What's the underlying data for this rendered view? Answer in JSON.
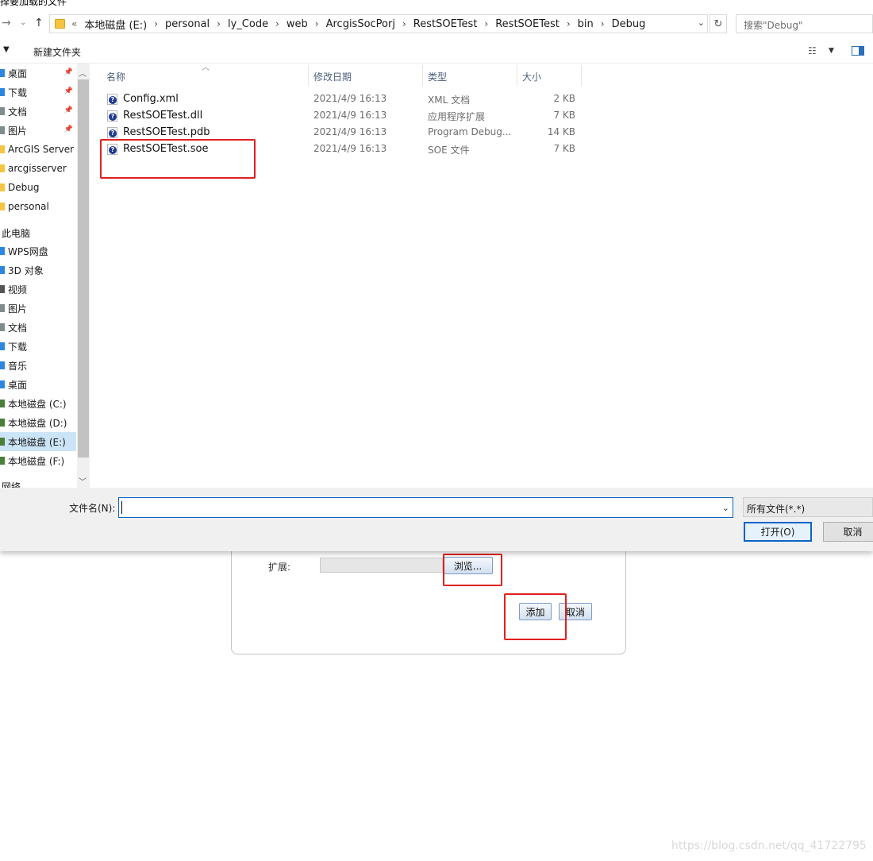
{
  "dialog": {
    "title": "择要加载的文件",
    "breadcrumb": [
      "本地磁盘 (E:)",
      "personal",
      "ly_Code",
      "web",
      "ArcgisSocPorj",
      "RestSOETest",
      "RestSOETest",
      "bin",
      "Debug"
    ],
    "breadcrumb_prefix": "«",
    "search_placeholder": "搜索\"Debug\"",
    "toolbar": {
      "new_folder": "新建文件夹"
    },
    "nav": {
      "quick_access": [
        {
          "label": "桌面",
          "icon": "desktop-icon",
          "color": "#2e86de",
          "pinned": true
        },
        {
          "label": "下载",
          "icon": "download-icon",
          "color": "#2e86de",
          "pinned": true
        },
        {
          "label": "文档",
          "icon": "document-icon",
          "color": "#7f8c8d",
          "pinned": true
        },
        {
          "label": "图片",
          "icon": "picture-icon",
          "color": "#7f8c8d",
          "pinned": true
        },
        {
          "label": "ArcGIS Server",
          "icon": "folder-icon",
          "color": "#f5c441",
          "pinned": false
        },
        {
          "label": "arcgisserver",
          "icon": "folder-icon",
          "color": "#f5c441",
          "pinned": false
        },
        {
          "label": "Debug",
          "icon": "folder-icon",
          "color": "#f5c441",
          "pinned": false
        },
        {
          "label": "personal",
          "icon": "folder-icon",
          "color": "#f5c441",
          "pinned": false
        }
      ],
      "this_pc_label": "此电脑",
      "this_pc": [
        {
          "label": "WPS网盘",
          "icon": "cloud-icon",
          "color": "#2e86de",
          "selected": false
        },
        {
          "label": "3D 对象",
          "icon": "cube-icon",
          "color": "#2e86de",
          "selected": false
        },
        {
          "label": "视频",
          "icon": "video-icon",
          "color": "#555555",
          "selected": false
        },
        {
          "label": "图片",
          "icon": "picture-icon",
          "color": "#7f8c8d",
          "selected": false
        },
        {
          "label": "文档",
          "icon": "document-icon",
          "color": "#7f8c8d",
          "selected": false
        },
        {
          "label": "下载",
          "icon": "download-icon",
          "color": "#2e86de",
          "selected": false
        },
        {
          "label": "音乐",
          "icon": "music-icon",
          "color": "#2e86de",
          "selected": false
        },
        {
          "label": "桌面",
          "icon": "desktop-icon",
          "color": "#2e86de",
          "selected": false
        },
        {
          "label": "本地磁盘 (C:)",
          "icon": "drive-icon",
          "color": "#4a7f3a",
          "selected": false
        },
        {
          "label": "本地磁盘 (D:)",
          "icon": "drive-icon",
          "color": "#4a7f3a",
          "selected": false
        },
        {
          "label": "本地磁盘 (E:)",
          "icon": "drive-icon",
          "color": "#4a7f3a",
          "selected": true
        },
        {
          "label": "本地磁盘 (F:)",
          "icon": "drive-icon",
          "color": "#4a7f3a",
          "selected": false
        }
      ],
      "network_label": "网络"
    },
    "columns": {
      "name": "名称",
      "date": "修改日期",
      "type": "类型",
      "size": "大小"
    },
    "files": [
      {
        "name": "Config.xml",
        "date": "2021/4/9 16:13",
        "type": "XML 文档",
        "size": "2 KB"
      },
      {
        "name": "RestSOETest.dll",
        "date": "2021/4/9 16:13",
        "type": "应用程序扩展",
        "size": "7 KB"
      },
      {
        "name": "RestSOETest.pdb",
        "date": "2021/4/9 16:13",
        "type": "Program Debug...",
        "size": "14 KB"
      },
      {
        "name": "RestSOETest.soe",
        "date": "2021/4/9 16:13",
        "type": "SOE 文件",
        "size": "7 KB"
      }
    ],
    "filename_label": "文件名(N):",
    "filename_value": "",
    "file_type": "所有文件(*.*)",
    "open_button": "打开(O)",
    "cancel_button": "取消"
  },
  "web_form": {
    "extension_label": "扩展:",
    "browse_button": "浏览...",
    "add_button": "添加",
    "cancel_button": "取消"
  },
  "watermark": "https://blog.csdn.net/qq_41722795",
  "accent_colors": {
    "highlight_red": "#e02020",
    "selection_blue": "#cce4f7",
    "focus_blue": "#0a64c8"
  }
}
